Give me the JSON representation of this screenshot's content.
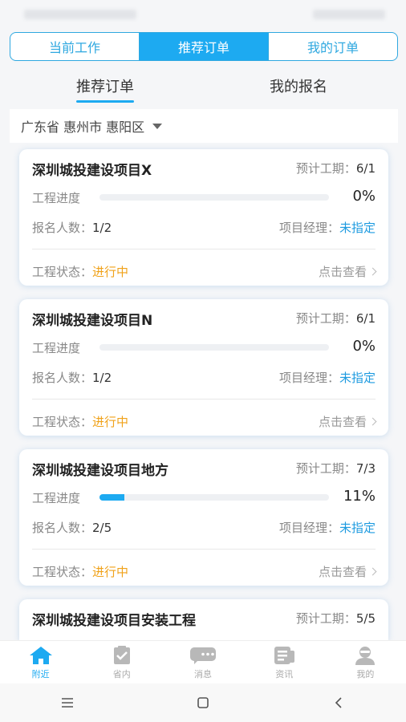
{
  "top_tabs": [
    {
      "label": "当前工作",
      "active": false
    },
    {
      "label": "推荐订单",
      "active": true
    },
    {
      "label": "我的订单",
      "active": false
    }
  ],
  "sub_tabs": [
    {
      "label": "推荐订单",
      "active": true
    },
    {
      "label": "我的报名",
      "active": false
    }
  ],
  "location": {
    "label": "广东省 惠州市 惠阳区"
  },
  "card_labels": {
    "period": "预计工期：",
    "progress": "工程进度",
    "signup": "报名人数：",
    "manager": "项目经理：",
    "state": "工程状态：",
    "view": "点击查看"
  },
  "orders": [
    {
      "title": "深圳城投建设项目X",
      "period": "6/1",
      "progress": 0,
      "progress_text": "0%",
      "signup": "1/2",
      "manager": "未指定",
      "state": "进行中"
    },
    {
      "title": "深圳城投建设项目N",
      "period": "6/1",
      "progress": 0,
      "progress_text": "0%",
      "signup": "1/2",
      "manager": "未指定",
      "state": "进行中"
    },
    {
      "title": "深圳城投建设项目地方",
      "period": "7/3",
      "progress": 11,
      "progress_text": "11%",
      "signup": "2/5",
      "manager": "未指定",
      "state": "进行中"
    },
    {
      "title": "深圳城投建设项目安装工程",
      "period": "5/5"
    }
  ],
  "tabbar": [
    {
      "label": "附近",
      "icon": "home-icon",
      "active": true
    },
    {
      "label": "省内",
      "icon": "clipboard-check-icon",
      "active": false
    },
    {
      "label": "消息",
      "icon": "chat-icon",
      "active": false
    },
    {
      "label": "资讯",
      "icon": "news-icon",
      "active": false
    },
    {
      "label": "我的",
      "icon": "user-icon",
      "active": false
    }
  ],
  "colors": {
    "accent": "#1daaf1",
    "warning": "#f0a21a",
    "link": "#1e9be0"
  }
}
